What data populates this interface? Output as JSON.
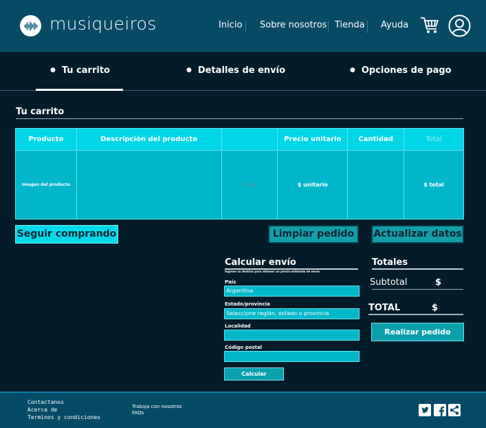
{
  "header": {
    "brand": "musiqueiros",
    "nav": [
      {
        "label": "Inicio"
      },
      {
        "label": "Sobre nosotros"
      },
      {
        "label": "Tienda"
      },
      {
        "label": "Ayuda"
      }
    ],
    "icons": {
      "logo": "soundwave-icon",
      "cart": "cart-icon",
      "user": "user-icon"
    }
  },
  "steps": [
    {
      "label": "Tu carrito",
      "active": true
    },
    {
      "label": "Detalles de envío",
      "active": false
    },
    {
      "label": "Opciones de pago",
      "active": false
    }
  ],
  "cart": {
    "title": "Tu carrito",
    "columns": [
      "Producto",
      "Descripción del producto",
      "",
      "Precio unitario",
      "Cantidad",
      "Total"
    ],
    "row": [
      "Imagen del producto",
      "",
      "Color",
      "$ unitario",
      "",
      "$ total"
    ]
  },
  "buttons": {
    "seguir": "Seguir comprando",
    "limpiar": "Limpiar pedido",
    "actualizar": "Actualizar datos"
  },
  "shipping": {
    "title": "Calcular envío",
    "subtitle": "Ingrese su destino para obtener un precio estimado de envío",
    "fields": [
      {
        "label": "País",
        "value": "Argentina"
      },
      {
        "label": "Estado/provincia",
        "value": "Seleccione región, estado o provincia"
      },
      {
        "label": "Localidad",
        "value": ""
      },
      {
        "label": "Código postal",
        "value": ""
      }
    ],
    "button": "Calcular"
  },
  "totals": {
    "title": "Totales",
    "subtotal_label": "Subtotal",
    "subtotal_value": "$",
    "total_label": "TOTAL",
    "total_value": "$",
    "button": "Realizar pedido"
  },
  "footer": {
    "col1": [
      "Contactanos",
      "Acerca de",
      "Terminos y condiciones"
    ],
    "col2": [
      "Trabaja con nosotros",
      "FAQs"
    ],
    "social": [
      "twitter-icon",
      "facebook-icon",
      "share-icon"
    ]
  },
  "colors": {
    "background": "#041b29",
    "header": "#064a66",
    "accent": "#00d6e6",
    "cell": "#00b6c9"
  }
}
